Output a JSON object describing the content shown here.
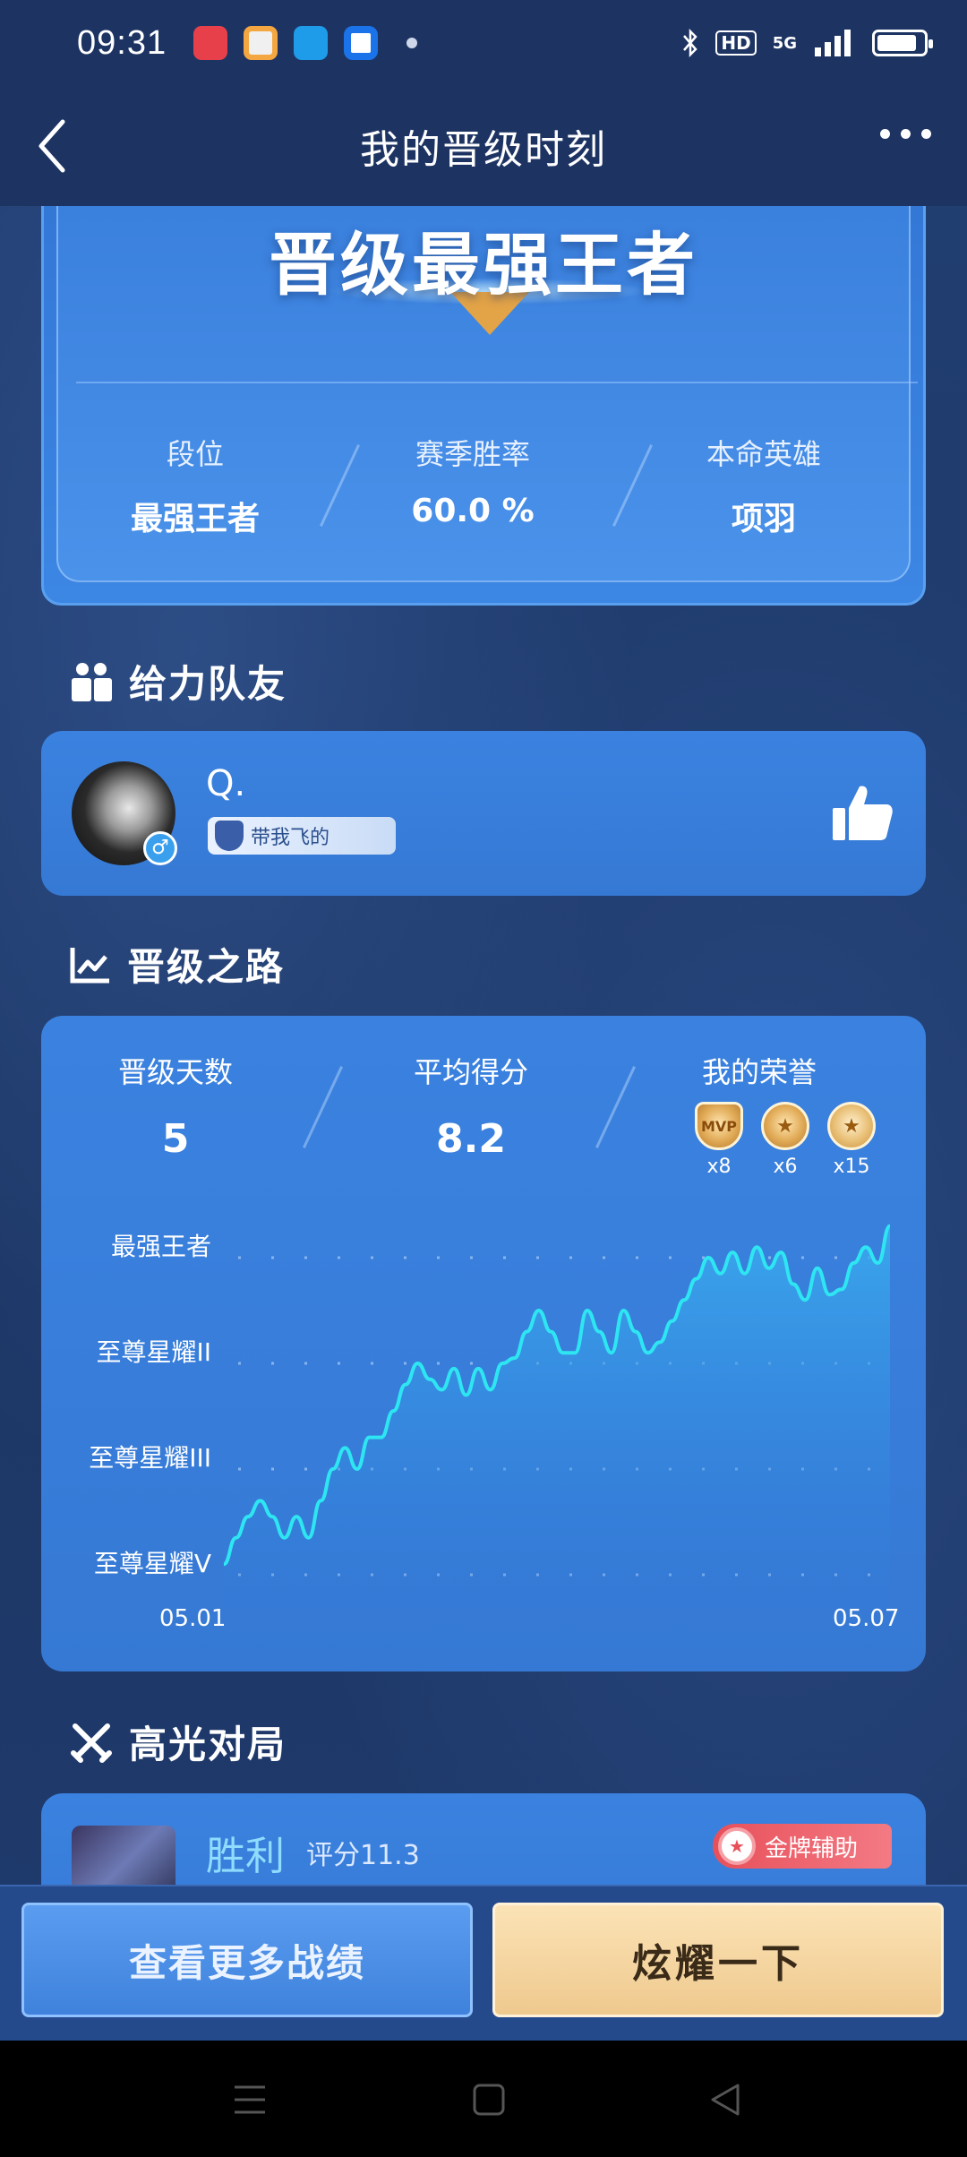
{
  "status_bar": {
    "time": "09:31",
    "network": "5G",
    "hd": "HD"
  },
  "nav": {
    "title": "我的晋级时刻"
  },
  "hero": {
    "title": "晋级最强王者",
    "stats": [
      {
        "label": "段位",
        "value": "最强王者"
      },
      {
        "label": "赛季胜率",
        "value": "60.0 %"
      },
      {
        "label": "本命英雄",
        "value": "项羽"
      }
    ]
  },
  "teammate_section": {
    "title": "给力队友",
    "name": "Q.",
    "tag": "带我飞的",
    "gender_symbol": "♂"
  },
  "progress_section": {
    "title": "晋级之路",
    "stats": [
      {
        "label": "晋级天数",
        "value": "5"
      },
      {
        "label": "平均得分",
        "value": "8.2"
      },
      {
        "label": "我的荣誉"
      }
    ],
    "honors": [
      {
        "icon": "mvp-medal-icon",
        "label": "MVP",
        "count": "x8"
      },
      {
        "icon": "gold-medal-icon",
        "count": "x6"
      },
      {
        "icon": "silver-medal-icon",
        "count": "x15"
      }
    ]
  },
  "chart_data": {
    "type": "area",
    "y_tier_labels": [
      "至尊星耀V",
      "至尊星耀III",
      "至尊星耀II",
      "最强王者"
    ],
    "x_range_labels": [
      "05.01",
      "05.07"
    ],
    "series": [
      {
        "values": [
          0.1,
          0.35,
          0.55,
          0.7,
          0.55,
          0.35,
          0.55,
          0.35,
          0.7,
          1.0,
          1.2,
          1.0,
          1.3,
          1.3,
          1.55,
          1.8,
          2.0,
          1.85,
          1.75,
          1.95,
          1.7,
          1.95,
          1.75,
          2.0,
          2.05,
          2.3,
          2.5,
          2.3,
          2.1,
          2.1,
          2.5,
          2.3,
          2.1,
          2.5,
          2.3,
          2.1,
          2.2,
          2.4,
          2.6,
          2.8,
          3.0,
          2.85,
          3.05,
          2.85,
          3.1,
          2.9,
          3.05,
          2.75,
          2.6,
          2.9,
          2.65,
          2.7,
          2.95,
          3.1,
          2.95,
          3.3
        ]
      }
    ],
    "colors": {
      "line": "#2ee6f2",
      "fill_top": "#37a9ef",
      "fill_bottom": "#2f7ad8"
    }
  },
  "highlight_section": {
    "title": "高光对局",
    "result": "胜利",
    "score": "评分11.3",
    "award": "金牌辅助"
  },
  "actions": {
    "more": "查看更多战绩",
    "show": "炫耀一下"
  },
  "colors": {
    "nav_bg": "#1d3463",
    "card_blue": "#3b82e0",
    "accent_gold": "#efc98e"
  }
}
